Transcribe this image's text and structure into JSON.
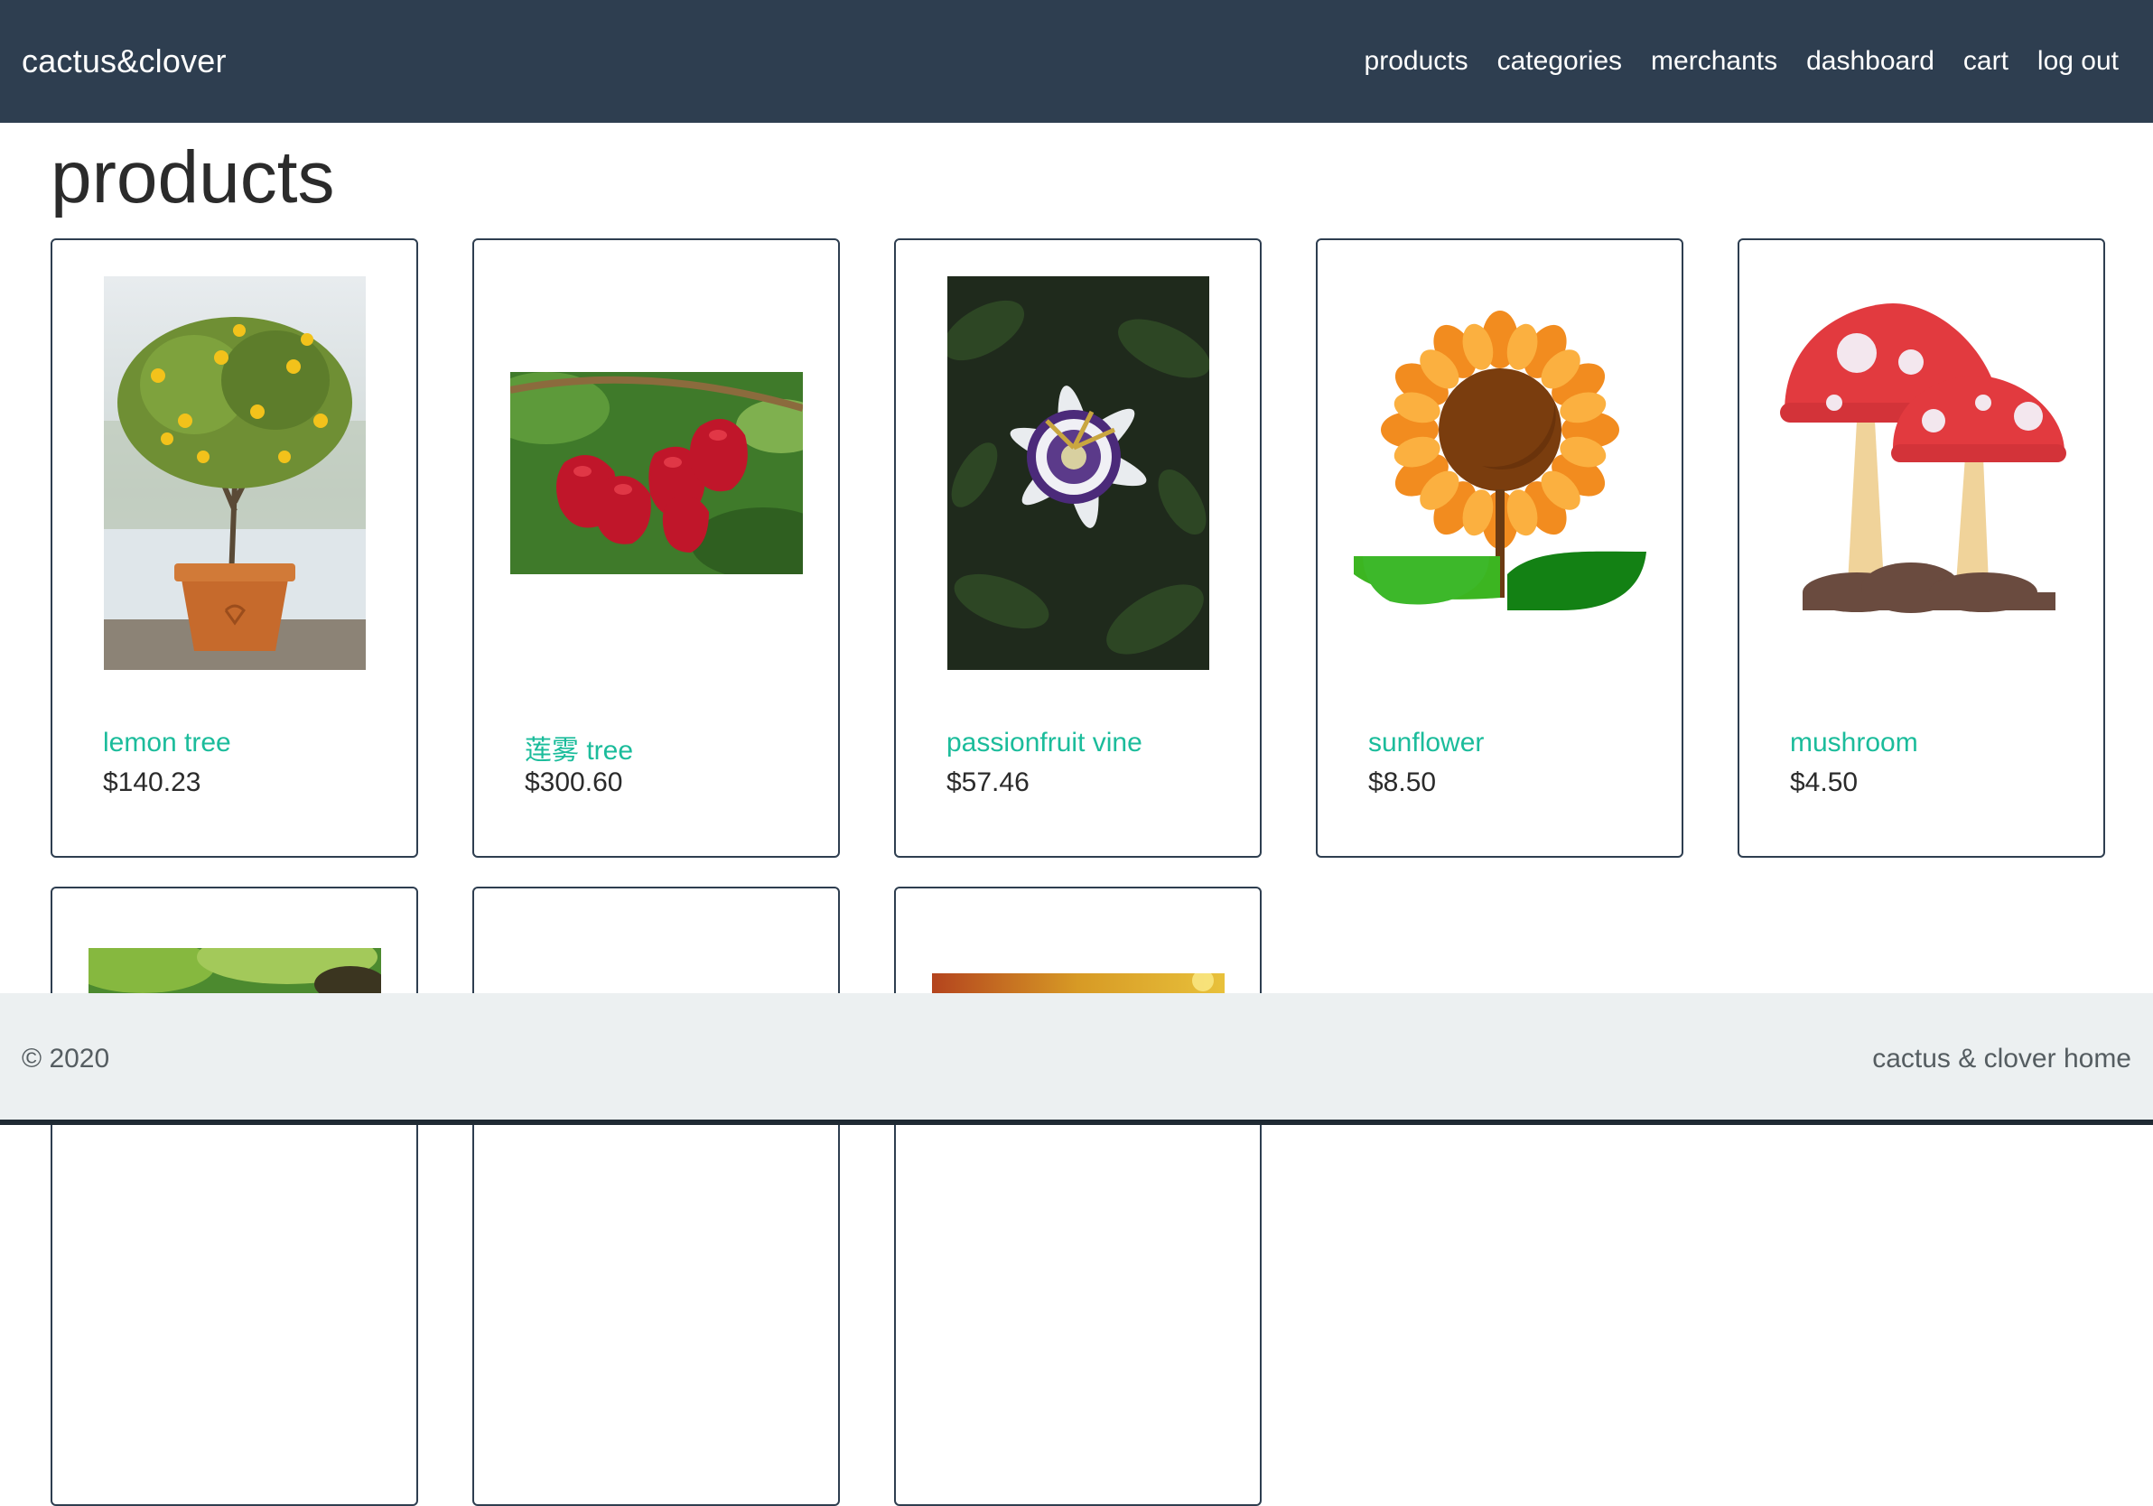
{
  "nav": {
    "brand": "cactus&clover",
    "links": [
      "products",
      "categories",
      "merchants",
      "dashboard",
      "cart",
      "log out"
    ]
  },
  "page": {
    "title": "products"
  },
  "products": [
    {
      "name": "lemon tree",
      "price": "$140.23",
      "image": "lemon-tree-photo"
    },
    {
      "name": "莲雾 tree",
      "price": "$300.60",
      "image": "wax-apple-photo"
    },
    {
      "name": "passionfruit vine",
      "price": "$57.46",
      "image": "passionflower-photo"
    },
    {
      "name": "sunflower",
      "price": "$8.50",
      "image": "sunflower-illustration"
    },
    {
      "name": "mushroom",
      "price": "$4.50",
      "image": "mushroom-illustration"
    }
  ],
  "footer": {
    "copyright": "© 2020",
    "home_link": "cactus & clover home"
  },
  "colors": {
    "navbar": "#2e3e50",
    "accent": "#1bbc9b",
    "footer": "#ecf0f1"
  }
}
